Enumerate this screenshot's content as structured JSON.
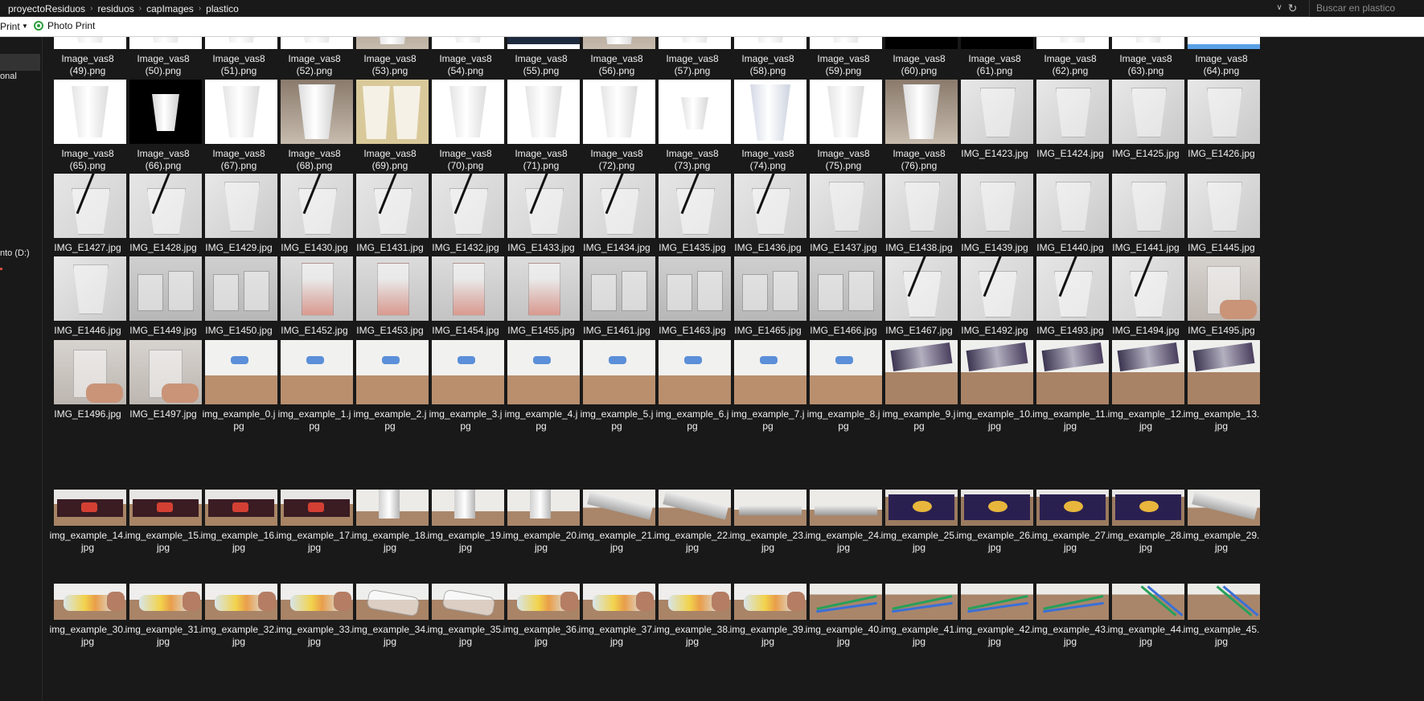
{
  "breadcrumb": [
    "proyectoResiduos",
    "residuos",
    "capImages",
    "plastico"
  ],
  "search": {
    "placeholder": "Buscar en plastico"
  },
  "toolbar": {
    "print_label": "Print",
    "photo_print_label": "Photo Print"
  },
  "nav": {
    "items": [
      "onal",
      "nto (D:)"
    ]
  },
  "grid": {
    "rows": [
      [
        {
          "label": "Image_vas8\n(49).png",
          "thumb": "t-cup"
        },
        {
          "label": "Image_vas8\n(50).png",
          "thumb": "t-cup"
        },
        {
          "label": "Image_vas8\n(51).png",
          "thumb": "t-cup"
        },
        {
          "label": "Image_vas8\n(52).png",
          "thumb": "t-cup"
        },
        {
          "label": "Image_vas8\n(53).png",
          "thumb": "t-cup-room"
        },
        {
          "label": "Image_vas8\n(54).png",
          "thumb": "t-cup"
        },
        {
          "label": "Image_vas8\n(55).png",
          "thumb": "t-top-dark"
        },
        {
          "label": "Image_vas8\n(56).png",
          "thumb": "t-cup-room"
        },
        {
          "label": "Image_vas8\n(57).png",
          "thumb": "t-cup"
        },
        {
          "label": "Image_vas8\n(58).png",
          "thumb": "t-cup"
        },
        {
          "label": "Image_vas8\n(59).png",
          "thumb": "t-cup"
        },
        {
          "label": "Image_vas8\n(60).png",
          "thumb": "t-cup-black"
        },
        {
          "label": "Image_vas8\n(61).png",
          "thumb": "t-cup-black"
        },
        {
          "label": "Image_vas8\n(62).png",
          "thumb": "t-cup"
        },
        {
          "label": "Image_vas8\n(63).png",
          "thumb": "t-cup"
        },
        {
          "label": "Image_vas8\n(64).png",
          "thumb": "t-top-blue"
        }
      ],
      [
        {
          "label": "Image_vas8\n(65).png",
          "thumb": "t-cup"
        },
        {
          "label": "Image_vas8\n(66).png",
          "thumb": "t-cup-black"
        },
        {
          "label": "Image_vas8\n(67).png",
          "thumb": "t-cup"
        },
        {
          "label": "Image_vas8\n(68).png",
          "thumb": "t-cup-room"
        },
        {
          "label": "Image_vas8\n(69).png",
          "thumb": "t-cup-print"
        },
        {
          "label": "Image_vas8\n(70).png",
          "thumb": "t-cup"
        },
        {
          "label": "Image_vas8\n(71).png",
          "thumb": "t-cup"
        },
        {
          "label": "Image_vas8\n(72).png",
          "thumb": "t-cup"
        },
        {
          "label": "Image_vas8\n(73).png",
          "thumb": "t-cup-small"
        },
        {
          "label": "Image_vas8\n(74).png",
          "thumb": "t-cup-blue"
        },
        {
          "label": "Image_vas8\n(75).png",
          "thumb": "t-cup"
        },
        {
          "label": "Image_vas8\n(76).png",
          "thumb": "t-cup-room"
        },
        {
          "label": "IMG_E1423.jpg",
          "thumb": "t-clear"
        },
        {
          "label": "IMG_E1424.jpg",
          "thumb": "t-clear"
        },
        {
          "label": "IMG_E1425.jpg",
          "thumb": "t-clear"
        },
        {
          "label": "IMG_E1426.jpg",
          "thumb": "t-clear"
        }
      ],
      [
        {
          "label": "IMG_E1427.jpg",
          "thumb": "t-straw"
        },
        {
          "label": "IMG_E1428.jpg",
          "thumb": "t-straw"
        },
        {
          "label": "IMG_E1429.jpg",
          "thumb": "t-clear"
        },
        {
          "label": "IMG_E1430.jpg",
          "thumb": "t-straw"
        },
        {
          "label": "IMG_E1431.jpg",
          "thumb": "t-straw"
        },
        {
          "label": "IMG_E1432.jpg",
          "thumb": "t-straw"
        },
        {
          "label": "IMG_E1433.jpg",
          "thumb": "t-straw"
        },
        {
          "label": "IMG_E1434.jpg",
          "thumb": "t-straw"
        },
        {
          "label": "IMG_E1435.jpg",
          "thumb": "t-straw"
        },
        {
          "label": "IMG_E1436.jpg",
          "thumb": "t-straw"
        },
        {
          "label": "IMG_E1437.jpg",
          "thumb": "t-clear"
        },
        {
          "label": "IMG_E1438.jpg",
          "thumb": "t-clear"
        },
        {
          "label": "IMG_E1439.jpg",
          "thumb": "t-clear"
        },
        {
          "label": "IMG_E1440.jpg",
          "thumb": "t-clear"
        },
        {
          "label": "IMG_E1441.jpg",
          "thumb": "t-clear"
        },
        {
          "label": "IMG_E1445.jpg",
          "thumb": "t-clear"
        }
      ],
      [
        {
          "label": "IMG_E1446.jpg",
          "thumb": "t-clear"
        },
        {
          "label": "IMG_E1449.jpg",
          "thumb": "t-multi"
        },
        {
          "label": "IMG_E1450.jpg",
          "thumb": "t-multi"
        },
        {
          "label": "IMG_E1452.jpg",
          "thumb": "t-pink"
        },
        {
          "label": "IMG_E1453.jpg",
          "thumb": "t-pink"
        },
        {
          "label": "IMG_E1454.jpg",
          "thumb": "t-pink"
        },
        {
          "label": "IMG_E1455.jpg",
          "thumb": "t-pink"
        },
        {
          "label": "IMG_E1461.jpg",
          "thumb": "t-multi"
        },
        {
          "label": "IMG_E1463.jpg",
          "thumb": "t-multi"
        },
        {
          "label": "IMG_E1465.jpg",
          "thumb": "t-multi"
        },
        {
          "label": "IMG_E1466.jpg",
          "thumb": "t-multi"
        },
        {
          "label": "IMG_E1467.jpg",
          "thumb": "t-straw"
        },
        {
          "label": "IMG_E1492.jpg",
          "thumb": "t-straw"
        },
        {
          "label": "IMG_E1493.jpg",
          "thumb": "t-straw"
        },
        {
          "label": "IMG_E1494.jpg",
          "thumb": "t-straw"
        },
        {
          "label": "IMG_E1495.jpg",
          "thumb": "t-hand"
        }
      ],
      [
        {
          "label": "IMG_E1496.jpg",
          "thumb": "t-hand"
        },
        {
          "label": "IMG_E1497.jpg",
          "thumb": "t-hand"
        },
        {
          "label": "img_example_0.j\npg",
          "thumb": "t-blue-bag"
        },
        {
          "label": "img_example_1.j\npg",
          "thumb": "t-blue-bag"
        },
        {
          "label": "img_example_2.j\npg",
          "thumb": "t-blue-bag"
        },
        {
          "label": "img_example_3.j\npg",
          "thumb": "t-blue-bag"
        },
        {
          "label": "img_example_4.j\npg",
          "thumb": "t-blue-bag"
        },
        {
          "label": "img_example_5.j\npg",
          "thumb": "t-blue-bag"
        },
        {
          "label": "img_example_6.j\npg",
          "thumb": "t-blue-bag"
        },
        {
          "label": "img_example_7.j\npg",
          "thumb": "t-blue-bag"
        },
        {
          "label": "img_example_8.j\npg",
          "thumb": "t-blue-bag"
        },
        {
          "label": "img_example_9.j\npg",
          "thumb": "t-wrapper"
        },
        {
          "label": "img_example_10.\njpg",
          "thumb": "t-wrapper"
        },
        {
          "label": "img_example_11.\njpg",
          "thumb": "t-wrapper"
        },
        {
          "label": "img_example_12.\njpg",
          "thumb": "t-wrapper"
        },
        {
          "label": "img_example_13.\njpg",
          "thumb": "t-wrapper"
        }
      ],
      [
        {
          "label": "img_example_14.\njpg",
          "thumb": "t-choco"
        },
        {
          "label": "img_example_15.\njpg",
          "thumb": "t-choco"
        },
        {
          "label": "img_example_16.\njpg",
          "thumb": "t-choco"
        },
        {
          "label": "img_example_17.\njpg",
          "thumb": "t-choco"
        },
        {
          "label": "img_example_18.\njpg",
          "thumb": "t-foil"
        },
        {
          "label": "img_example_19.\njpg",
          "thumb": "t-foil"
        },
        {
          "label": "img_example_20.\njpg",
          "thumb": "t-foil"
        },
        {
          "label": "img_example_21.\njpg",
          "thumb": "t-foil-diag"
        },
        {
          "label": "img_example_22.\njpg",
          "thumb": "t-foil-diag"
        },
        {
          "label": "img_example_23.\njpg",
          "thumb": "t-foil-flat"
        },
        {
          "label": "img_example_24.\njpg",
          "thumb": "t-foil-flat"
        },
        {
          "label": "img_example_25.\njpg",
          "thumb": "t-hoyo"
        },
        {
          "label": "img_example_26.\njpg",
          "thumb": "t-hoyo"
        },
        {
          "label": "img_example_27.\njpg",
          "thumb": "t-hoyo"
        },
        {
          "label": "img_example_28.\njpg",
          "thumb": "t-hoyo"
        },
        {
          "label": "img_example_29.\njpg",
          "thumb": "t-foil-diag"
        }
      ],
      [
        {
          "label": "img_example_30.\njpg",
          "thumb": "t-bottle"
        },
        {
          "label": "img_example_31.\njpg",
          "thumb": "t-bottle"
        },
        {
          "label": "img_example_32.\njpg",
          "thumb": "t-bottle"
        },
        {
          "label": "img_example_33.\njpg",
          "thumb": "t-bottle"
        },
        {
          "label": "img_example_34.\njpg",
          "thumb": "t-clearbottle"
        },
        {
          "label": "img_example_35.\njpg",
          "thumb": "t-clearbottle"
        },
        {
          "label": "img_example_36.\njpg",
          "thumb": "t-bottle"
        },
        {
          "label": "img_example_37.\njpg",
          "thumb": "t-bottle"
        },
        {
          "label": "img_example_38.\njpg",
          "thumb": "t-bottle"
        },
        {
          "label": "img_example_39.\njpg",
          "thumb": "t-bottle"
        },
        {
          "label": "img_example_40.\njpg",
          "thumb": "t-straws"
        },
        {
          "label": "img_example_41.\njpg",
          "thumb": "t-straws"
        },
        {
          "label": "img_example_42.\njpg",
          "thumb": "t-straws"
        },
        {
          "label": "img_example_43.\njpg",
          "thumb": "t-straws"
        },
        {
          "label": "img_example_44.\njpg",
          "thumb": "t-straws-diag"
        },
        {
          "label": "img_example_45.\njpg",
          "thumb": "t-straws-diag"
        }
      ]
    ]
  }
}
